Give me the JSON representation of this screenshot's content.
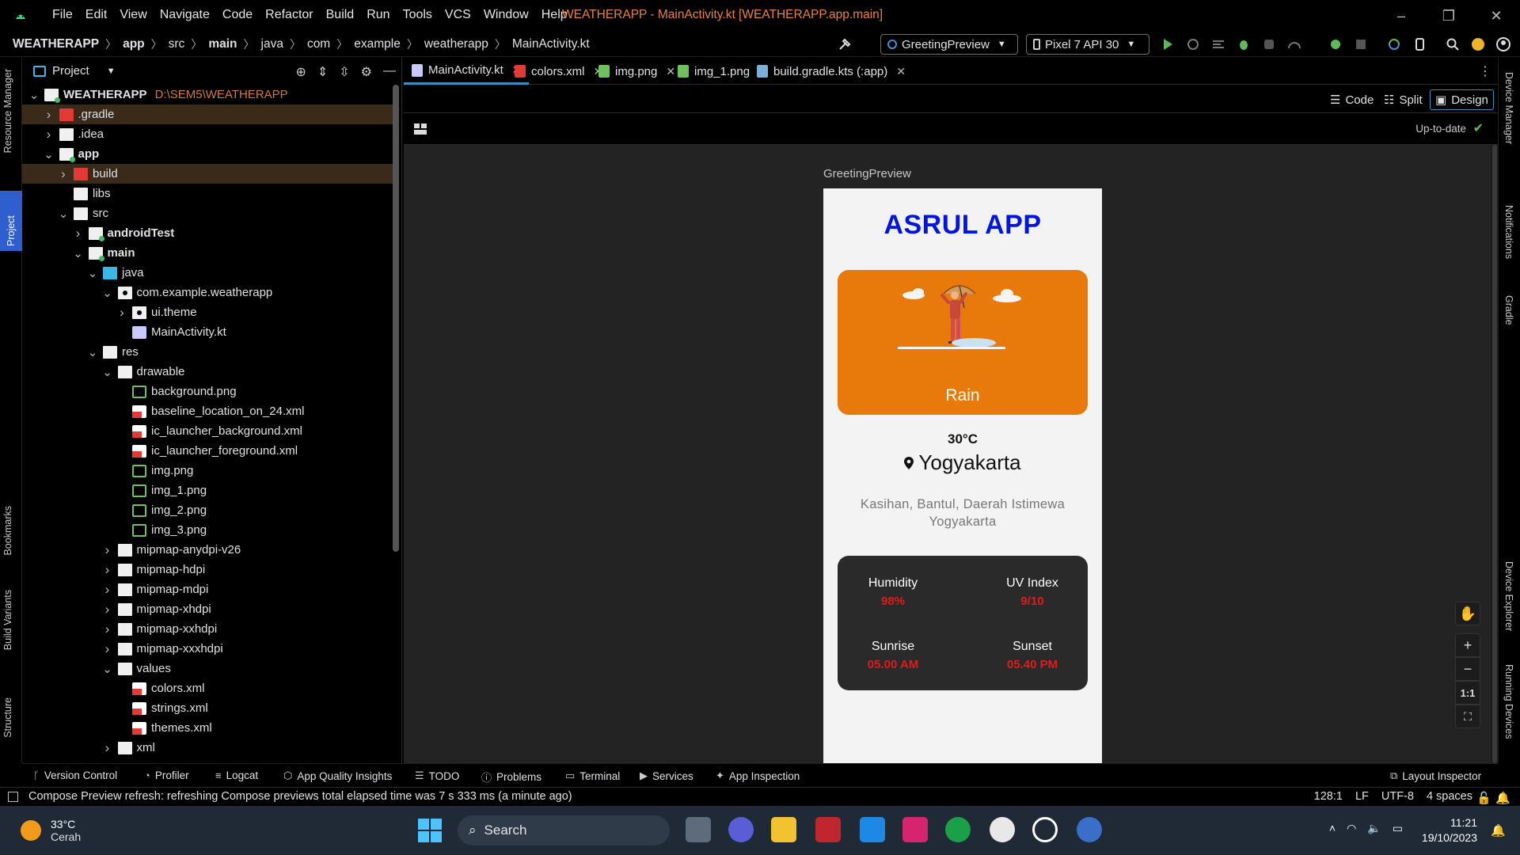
{
  "menubar": {
    "items": [
      "File",
      "Edit",
      "View",
      "Navigate",
      "Code",
      "Refactor",
      "Build",
      "Run",
      "Tools",
      "VCS",
      "Window",
      "Help"
    ],
    "window_title": "WEATHERAPP - MainActivity.kt [WEATHERAPP.app.main]"
  },
  "navbar": {
    "crumbs": [
      "WEATHERAPP",
      "app",
      "src",
      "main",
      "java",
      "com",
      "example",
      "weatherapp",
      "MainActivity.kt"
    ],
    "run_config": "GreetingPreview",
    "device": "Pixel 7 API 30"
  },
  "left_stripe": {
    "tabs": [
      "Resource Manager",
      "Project",
      "Bookmarks",
      "Build Variants",
      "Structure"
    ]
  },
  "right_stripe": {
    "tabs": [
      "Device Manager",
      "Notifications",
      "Gradle",
      "Device Explorer",
      "Running Devices"
    ]
  },
  "project": {
    "title": "Project",
    "tree": [
      {
        "label": "WEATHERAPP",
        "path": "D:\\SEM5\\WEATHERAPP",
        "depth": 0,
        "arrow": "down",
        "icon": "module-folder",
        "bold": true
      },
      {
        "label": ".gradle",
        "depth": 1,
        "arrow": "right",
        "icon": "folder-red",
        "hl": true
      },
      {
        "label": ".idea",
        "depth": 1,
        "arrow": "right",
        "icon": "folder"
      },
      {
        "label": "app",
        "depth": 1,
        "arrow": "down",
        "icon": "module-folder",
        "bold": true
      },
      {
        "label": "build",
        "depth": 2,
        "arrow": "right",
        "icon": "folder-red",
        "hl": true
      },
      {
        "label": "libs",
        "depth": 2,
        "arrow": "",
        "icon": "folder"
      },
      {
        "label": "src",
        "depth": 2,
        "arrow": "down",
        "icon": "folder"
      },
      {
        "label": "androidTest",
        "depth": 3,
        "arrow": "right",
        "icon": "folder-green",
        "bold": true
      },
      {
        "label": "main",
        "depth": 3,
        "arrow": "down",
        "icon": "folder-green",
        "bold": true
      },
      {
        "label": "java",
        "depth": 4,
        "arrow": "down",
        "icon": "folder-cyan"
      },
      {
        "label": "com.example.weatherapp",
        "depth": 5,
        "arrow": "down",
        "icon": "package"
      },
      {
        "label": "ui.theme",
        "depth": 6,
        "arrow": "right",
        "icon": "package"
      },
      {
        "label": "MainActivity.kt",
        "depth": 6,
        "arrow": "",
        "icon": "file-kt"
      },
      {
        "label": "res",
        "depth": 4,
        "arrow": "down",
        "icon": "folder-res"
      },
      {
        "label": "drawable",
        "depth": 5,
        "arrow": "down",
        "icon": "folder"
      },
      {
        "label": "background.png",
        "depth": 6,
        "arrow": "",
        "icon": "file-img"
      },
      {
        "label": "baseline_location_on_24.xml",
        "depth": 6,
        "arrow": "",
        "icon": "file-xml"
      },
      {
        "label": "ic_launcher_background.xml",
        "depth": 6,
        "arrow": "",
        "icon": "file-xml"
      },
      {
        "label": "ic_launcher_foreground.xml",
        "depth": 6,
        "arrow": "",
        "icon": "file-xml"
      },
      {
        "label": "img.png",
        "depth": 6,
        "arrow": "",
        "icon": "file-img"
      },
      {
        "label": "img_1.png",
        "depth": 6,
        "arrow": "",
        "icon": "file-img"
      },
      {
        "label": "img_2.png",
        "depth": 6,
        "arrow": "",
        "icon": "file-img"
      },
      {
        "label": "img_3.png",
        "depth": 6,
        "arrow": "",
        "icon": "file-img"
      },
      {
        "label": "mipmap-anydpi-v26",
        "depth": 5,
        "arrow": "right",
        "icon": "folder"
      },
      {
        "label": "mipmap-hdpi",
        "depth": 5,
        "arrow": "right",
        "icon": "folder"
      },
      {
        "label": "mipmap-mdpi",
        "depth": 5,
        "arrow": "right",
        "icon": "folder"
      },
      {
        "label": "mipmap-xhdpi",
        "depth": 5,
        "arrow": "right",
        "icon": "folder"
      },
      {
        "label": "mipmap-xxhdpi",
        "depth": 5,
        "arrow": "right",
        "icon": "folder"
      },
      {
        "label": "mipmap-xxxhdpi",
        "depth": 5,
        "arrow": "right",
        "icon": "folder"
      },
      {
        "label": "values",
        "depth": 5,
        "arrow": "down",
        "icon": "folder"
      },
      {
        "label": "colors.xml",
        "depth": 6,
        "arrow": "",
        "icon": "file-xml"
      },
      {
        "label": "strings.xml",
        "depth": 6,
        "arrow": "",
        "icon": "file-xml"
      },
      {
        "label": "themes.xml",
        "depth": 6,
        "arrow": "",
        "icon": "file-xml"
      },
      {
        "label": "xml",
        "depth": 5,
        "arrow": "right",
        "icon": "folder"
      }
    ]
  },
  "editor": {
    "tabs": [
      {
        "label": "MainActivity.kt",
        "active": true,
        "icon": "file-kt"
      },
      {
        "label": "colors.xml",
        "active": false,
        "icon": "file-xml"
      },
      {
        "label": "img.png",
        "active": false,
        "icon": "file-img"
      },
      {
        "label": "img_1.png",
        "active": false,
        "icon": "file-img"
      },
      {
        "label": "build.gradle.kts (:app)",
        "active": false,
        "icon": "gradle"
      }
    ],
    "view_modes": {
      "code": "Code",
      "split": "Split",
      "design": "Design"
    },
    "status": "Up-to-date"
  },
  "preview": {
    "label": "GreetingPreview",
    "app_title": "ASRUL APP",
    "condition": "Rain",
    "temperature": "30°C",
    "city": "Yogyakarta",
    "address": "Kasihan, Bantul, Daerah Istimewa Yogyakarta",
    "stats": {
      "humidity_label": "Humidity",
      "humidity_value": "98%",
      "uv_label": "UV Index",
      "uv_value": "9/10",
      "sunrise_label": "Sunrise",
      "sunrise_value": "05.00 AM",
      "sunset_label": "Sunset",
      "sunset_value": "05.40 PM"
    },
    "colors": {
      "title": "#0014e6",
      "card": "#e77a0b",
      "stat_value": "#e11b1b",
      "stat_bg": "#2a2a2a"
    }
  },
  "zoom": {
    "one_to_one": "1:1"
  },
  "toolwindows": [
    "Version Control",
    "Profiler",
    "Logcat",
    "App Quality Insights",
    "TODO",
    "Problems",
    "Terminal",
    "Services",
    "App Inspection",
    "Layout Inspector"
  ],
  "statusbar": {
    "message": "Compose Preview refresh: refreshing Compose previews total elapsed time was 7 s 333 ms (a minute ago)",
    "position": "128:1",
    "line_sep": "LF",
    "encoding": "UTF-8",
    "indent": "4 spaces"
  },
  "taskbar": {
    "weather_temp": "33°C",
    "weather_desc": "Cerah",
    "search": "Search",
    "time": "11:21",
    "date": "19/10/2023"
  }
}
